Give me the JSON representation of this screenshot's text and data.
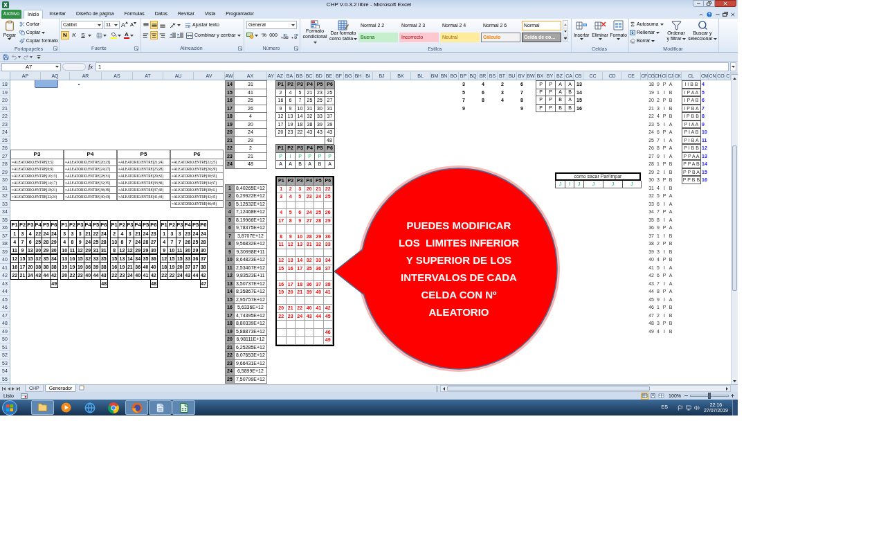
{
  "window": {
    "title": "CHP V.0.3.2 libre - Microsoft Excel"
  },
  "ribbon_tabs": [
    {
      "label": "Archivo",
      "kind": "file",
      "selected": false
    },
    {
      "label": "Inicio",
      "kind": "tab",
      "selected": true
    },
    {
      "label": "Insertar",
      "kind": "tab",
      "selected": false
    },
    {
      "label": "Diseño de página",
      "kind": "tab",
      "selected": false
    },
    {
      "label": "Fórmulas",
      "kind": "tab",
      "selected": false
    },
    {
      "label": "Datos",
      "kind": "tab",
      "selected": false
    },
    {
      "label": "Revisar",
      "kind": "tab",
      "selected": false
    },
    {
      "label": "Vista",
      "kind": "tab",
      "selected": false
    },
    {
      "label": "Programador",
      "kind": "tab",
      "selected": false
    }
  ],
  "clipboard": {
    "group": "Portapapeles",
    "paste": "Pegar",
    "actions": [
      {
        "label": "Cortar",
        "kind": "cut"
      },
      {
        "label": "Copiar",
        "kind": "copy"
      },
      {
        "label": "Copiar formato",
        "kind": "format_painter"
      }
    ]
  },
  "font": {
    "group": "Fuente",
    "family": "Calibri",
    "size": "11",
    "grow": "A",
    "shrink": "A",
    "styles": [
      {
        "label": "N",
        "kind": "bold",
        "selected": true
      },
      {
        "label": "K",
        "kind": "italic",
        "selected": false
      },
      {
        "label": "S",
        "kind": "underline",
        "selected": false
      }
    ],
    "color_glyph": "A"
  },
  "alignment": {
    "group": "Alineación",
    "vertical": [
      {
        "kind": "top",
        "selected": false
      },
      {
        "kind": "middle",
        "selected": true
      },
      {
        "kind": "bottom",
        "selected": false
      }
    ],
    "horizontal": [
      {
        "kind": "left",
        "selected": false
      },
      {
        "kind": "center",
        "selected": true
      },
      {
        "kind": "right",
        "selected": false
      }
    ],
    "wrap": "Ajustar texto",
    "merge": "Combinar y centrar"
  },
  "number": {
    "group": "Número",
    "format": "General",
    "percent": "%",
    "thousands": "000"
  },
  "styles": {
    "group": "Estilos",
    "conditional": "Formato\ncondicional",
    "as_table": "Dar formato\ncomo tabla",
    "gallery": [
      {
        "label": "Normal 2 2",
        "kind": "plain",
        "selected": false
      },
      {
        "label": "Normal 2 3",
        "kind": "plain",
        "selected": false
      },
      {
        "label": "Normal 2 4",
        "kind": "plain",
        "selected": false
      },
      {
        "label": "Normal 2 6",
        "kind": "plain",
        "selected": false
      },
      {
        "label": "Normal",
        "kind": "plain",
        "selected": true
      },
      {
        "label": "Buena",
        "kind": "good",
        "selected": false
      },
      {
        "label": "Incorrecto",
        "kind": "bad",
        "selected": false
      },
      {
        "label": "Neutral",
        "kind": "neutral",
        "selected": false
      },
      {
        "label": "Cálculo",
        "kind": "calc",
        "selected": false
      },
      {
        "label": "Celda de co...",
        "kind": "check",
        "selected": false
      }
    ]
  },
  "cells": {
    "group": "Celdas",
    "buttons": [
      {
        "label": "Insertar",
        "kind": "insert"
      },
      {
        "label": "Eliminar",
        "kind": "delete"
      },
      {
        "label": "Formato",
        "kind": "format"
      }
    ]
  },
  "editing": {
    "group": "Modificar",
    "actions": [
      {
        "label": "Autosuma",
        "kind": "autosum"
      },
      {
        "label": "Rellenar",
        "kind": "fill"
      },
      {
        "label": "Borrar",
        "kind": "clear"
      }
    ],
    "sort": "Ordenar\ny filtrar",
    "find": "Buscar y\nseleccionar"
  },
  "formula_bar": {
    "name_box": "A7",
    "fx": "fx",
    "value": "1"
  },
  "column_headers": [
    "AP",
    "AQ",
    "AR",
    "AS",
    "AT",
    "AU",
    "AV",
    "AW",
    "AX",
    "AY",
    "AZ",
    "BA",
    "BB",
    "BC",
    "BD",
    "BE",
    "BF",
    "BG",
    "BH",
    "BI",
    "BJ",
    "BK",
    "BL",
    "BM",
    "BN",
    "BO",
    "BP",
    "BQ",
    "BR",
    "BS",
    "BT",
    "BU",
    "BV",
    "BW",
    "BX",
    "BY",
    "BZ",
    "CA",
    "CB",
    "CC",
    "CD",
    "CE",
    "CF",
    "CG",
    "CH",
    "CI",
    "CJ",
    "CK",
    "CL",
    "CM",
    "CN",
    "CO",
    "C"
  ],
  "row_headers": [
    "18",
    "19",
    "20",
    "21",
    "22",
    "23",
    "24",
    "25",
    "26",
    "27",
    "28",
    "29",
    "30",
    "31",
    "32",
    "33",
    "34",
    "35",
    "36",
    "37",
    "38",
    "39",
    "40",
    "41",
    "42",
    "43",
    "44",
    "45",
    "46",
    "47",
    "48",
    "49",
    "50",
    "51",
    "52",
    "53",
    "54",
    "55"
  ],
  "sheet": {
    "interval_formulas": [
      {
        "header": "P3",
        "formulas": [
          "=ALEATORIO.ENTRE(3;5)",
          "=ALEATORIO.ENTRE(6;9)",
          "=ALEATORIO.ENTRE(10;13)",
          "=ALEATORIO.ENTRE(14;17)",
          "=ALEATORIO.ENTRE(18;21)",
          "=ALEATORIO.ENTRE(22;24)"
        ]
      },
      {
        "header": "P4",
        "formulas": [
          "=ALEATORIO.ENTRE(20;23)",
          "=ALEATORIO.ENTRE(24;27)",
          "=ALEATORIO.ENTRE(28;31)",
          "=ALEATORIO.ENTRE(32;35)",
          "=ALEATORIO.ENTRE(36;39)",
          "=ALEATORIO.ENTRE(40;43)"
        ]
      },
      {
        "header": "P5",
        "formulas": [
          "=ALEATORIO.ENTRE(21;24)",
          "=ALEATORIO.ENTRE(25;28)",
          "=ALEATORIO.ENTRE(29;32)",
          "=ALEATORIO.ENTRE(33;36)",
          "=ALEATORIO.ENTRE(37;40)",
          "=ALEATORIO.ENTRE(41;44)"
        ]
      },
      {
        "header": "P6",
        "formulas": [
          "=ALEATORIO.ENTRE(22;25)",
          "=ALEATORIO.ENTRE(26;29)",
          "=ALEATORIO.ENTRE(30;33)",
          "=ALEATORIO.ENTRE(34;37)",
          "=ALEATORIO.ENTRE(38;41)",
          "=ALEATORIO.ENTRE(42;45)",
          "=ALEATORIO.ENTRE(46;49)"
        ]
      }
    ],
    "draw_grids": [
      {
        "headers": [
          "P1",
          "P2",
          "P3",
          "P4",
          "P5",
          "P6"
        ],
        "rows": [
          [
            "1",
            "3",
            "4",
            "22",
            "24",
            "24"
          ],
          [
            "4",
            "7",
            "6",
            "25",
            "28",
            "29"
          ],
          [
            "11",
            "9",
            "13",
            "30",
            "29",
            "30"
          ],
          [
            "12",
            "15",
            "15",
            "32",
            "35",
            "34"
          ],
          [
            "16",
            "17",
            "20",
            "38",
            "38",
            "38"
          ],
          [
            "22",
            "21",
            "24",
            "43",
            "44",
            "42"
          ]
        ],
        "extra": "49"
      },
      {
        "headers": [
          "P1",
          "P2",
          "P3",
          "P4",
          "P5",
          "P6"
        ],
        "rows": [
          [
            "3",
            "3",
            "3",
            "21",
            "22",
            "24"
          ],
          [
            "4",
            "8",
            "9",
            "24",
            "25",
            "28"
          ],
          [
            "10",
            "11",
            "12",
            "29",
            "31",
            "31"
          ],
          [
            "13",
            "16",
            "15",
            "32",
            "33",
            "35"
          ],
          [
            "19",
            "19",
            "19",
            "36",
            "39",
            "38"
          ],
          [
            "20",
            "22",
            "23",
            "40",
            "44",
            "43"
          ]
        ],
        "extra": "48"
      },
      {
        "headers": [
          "P1",
          "P2",
          "P3",
          "P4",
          "P5",
          "P6"
        ],
        "rows": [
          [
            "2",
            "4",
            "3",
            "21",
            "24",
            "23"
          ],
          [
            "13",
            "8",
            "7",
            "24",
            "28",
            "27"
          ],
          [
            "8",
            "12",
            "12",
            "29",
            "29",
            "30"
          ],
          [
            "15",
            "13",
            "14",
            "34",
            "35",
            "36"
          ],
          [
            "16",
            "19",
            "21",
            "36",
            "40",
            "40"
          ],
          [
            "22",
            "23",
            "24",
            "40",
            "41",
            "42"
          ]
        ],
        "extra": "48"
      },
      {
        "headers": [
          "P1",
          "P2",
          "P3",
          "P4",
          "P5",
          "P6"
        ],
        "rows": [
          [
            "1",
            "3",
            "3",
            "23",
            "24",
            "24"
          ],
          [
            "4",
            "7",
            "7",
            "26",
            "25",
            "28"
          ],
          [
            "9",
            "10",
            "11",
            "30",
            "29",
            "30"
          ],
          [
            "12",
            "15",
            "15",
            "33",
            "36",
            "37"
          ],
          [
            "18",
            "19",
            "20",
            "37",
            "37",
            "38"
          ],
          [
            "22",
            "22",
            "24",
            "43",
            "44",
            "42"
          ]
        ],
        "extra": "47"
      }
    ],
    "index_values_top": [
      {
        "index": "14",
        "value": "31"
      },
      {
        "index": "15",
        "value": "41"
      },
      {
        "index": "16",
        "value": "25"
      },
      {
        "index": "17",
        "value": "26"
      },
      {
        "index": "18",
        "value": "4"
      },
      {
        "index": "19",
        "value": "20"
      },
      {
        "index": "20",
        "value": "24"
      },
      {
        "index": "21",
        "value": "29"
      },
      {
        "index": "22",
        "value": "2"
      },
      {
        "index": "23",
        "value": "21"
      },
      {
        "index": "24",
        "value": "48"
      }
    ],
    "index_values": [
      {
        "index": "1",
        "value": "8,40265E+12"
      },
      {
        "index": "2",
        "value": "6,29922E+12"
      },
      {
        "index": "3",
        "value": "5,12532E+12"
      },
      {
        "index": "4",
        "value": "7,12468E+12"
      },
      {
        "index": "5",
        "value": "8,19966E+12"
      },
      {
        "index": "6",
        "value": "9,78375E+12"
      },
      {
        "index": "7",
        "value": "3,8707E+12"
      },
      {
        "index": "8",
        "value": "9,56832E+12"
      },
      {
        "index": "9",
        "value": "9,30998E+11"
      },
      {
        "index": "10",
        "value": "8,64823E+12"
      },
      {
        "index": "11",
        "value": "2,53467E+12"
      },
      {
        "index": "12",
        "value": "9,83523E+11"
      },
      {
        "index": "13",
        "value": "3,50737E+12"
      },
      {
        "index": "14",
        "value": "8,35867E+12"
      },
      {
        "index": "15",
        "value": "2,95757E+12"
      },
      {
        "index": "16",
        "value": "5,6336E+12"
      },
      {
        "index": "17",
        "value": "4,74395E+12"
      },
      {
        "index": "18",
        "value": "8,80339E+12"
      },
      {
        "index": "19",
        "value": "5,88873E+12"
      },
      {
        "index": "20",
        "value": "6,98111E+12"
      },
      {
        "index": "21",
        "value": "6,25285E+12"
      },
      {
        "index": "22",
        "value": "8,07653E+12"
      },
      {
        "index": "23",
        "value": "9,66431E+12"
      },
      {
        "index": "24",
        "value": "6,5899E+12"
      },
      {
        "index": "25",
        "value": "7,50799E+12"
      }
    ],
    "combination_table": {
      "headers": [
        "P1",
        "P2",
        "P3",
        "P4",
        "P5",
        "P6"
      ],
      "rows": [
        [
          "2",
          "4",
          "5",
          "21",
          "23",
          "25"
        ],
        [
          "16",
          "6",
          "7",
          "25",
          "25",
          "27"
        ],
        [
          "9",
          "9",
          "10",
          "31",
          "30",
          "31"
        ],
        [
          "12",
          "13",
          "14",
          "32",
          "33",
          "37"
        ],
        [
          "17",
          "19",
          "18",
          "38",
          "39",
          "39"
        ],
        [
          "20",
          "23",
          "22",
          "43",
          "43",
          "43"
        ]
      ],
      "extra": "48"
    },
    "parity_table": {
      "headers": [
        "P1",
        "P2",
        "P3",
        "P4",
        "P5",
        "P6"
      ],
      "parity": [
        "P",
        "I",
        "P",
        "P",
        "P",
        "P"
      ],
      "letters": [
        "A",
        "A",
        "B",
        "A",
        "B",
        "A"
      ]
    },
    "red_table": {
      "headers": [
        "P1",
        "P2",
        "P3",
        "P4",
        "P5",
        "P6"
      ],
      "rows": [
        {
          "kind": "numbers",
          "values": [
            "1",
            "2",
            "3",
            "20",
            "21",
            "22"
          ]
        },
        {
          "kind": "numbers",
          "values": [
            "3",
            "4",
            "5",
            "23",
            "24",
            "25"
          ]
        },
        {
          "kind": "blank"
        },
        {
          "kind": "numbers",
          "values": [
            "4",
            "5",
            "6",
            "24",
            "25",
            "26"
          ]
        },
        {
          "kind": "numbers",
          "values": [
            "17",
            "8",
            "9",
            "27",
            "28",
            "29"
          ]
        },
        {
          "kind": "blank"
        },
        {
          "kind": "numbers",
          "values": [
            "8",
            "9",
            "10",
            "28",
            "29",
            "30"
          ]
        },
        {
          "kind": "numbers",
          "values": [
            "11",
            "12",
            "13",
            "31",
            "32",
            "33"
          ]
        },
        {
          "kind": "blank"
        },
        {
          "kind": "numbers",
          "values": [
            "12",
            "13",
            "14",
            "32",
            "33",
            "34"
          ]
        },
        {
          "kind": "numbers",
          "values": [
            "15",
            "16",
            "17",
            "35",
            "36",
            "37"
          ]
        },
        {
          "kind": "blank"
        },
        {
          "kind": "numbers",
          "values": [
            "16",
            "17",
            "18",
            "36",
            "37",
            "38"
          ]
        },
        {
          "kind": "numbers",
          "values": [
            "19",
            "20",
            "21",
            "39",
            "40",
            "41"
          ]
        },
        {
          "kind": "blank"
        },
        {
          "kind": "numbers",
          "values": [
            "20",
            "21",
            "22",
            "40",
            "41",
            "42"
          ]
        },
        {
          "kind": "numbers",
          "values": [
            "22",
            "23",
            "24",
            "43",
            "44",
            "45"
          ]
        },
        {
          "kind": "blank"
        },
        {
          "kind": "last",
          "value": "46"
        },
        {
          "kind": "last",
          "value": "49"
        }
      ]
    },
    "small_numbers": [
      [
        "3",
        "5",
        "7",
        "9"
      ],
      [
        "4",
        "6",
        "8"
      ],
      [
        "2",
        "3",
        "4"
      ],
      [
        "6",
        "7",
        "8",
        "9"
      ]
    ],
    "pattern_table": [
      {
        "cells": [
          "P",
          "P",
          "A",
          "A"
        ],
        "number": "13"
      },
      {
        "cells": [
          "P",
          "P",
          "A",
          "B"
        ],
        "number": "14"
      },
      {
        "cells": [
          "P",
          "P",
          "B",
          "A"
        ],
        "number": "15"
      },
      {
        "cells": [
          "P",
          "P",
          "B",
          "B"
        ],
        "number": "16"
      }
    ],
    "par_impar_box": {
      "title": "como sacar Par/Impar",
      "cells": [
        "J",
        "I",
        "J",
        "J",
        "J",
        "J"
      ]
    },
    "sequence": [
      {
        "n": "18",
        "digit": "9",
        "parity": "P",
        "group": "A"
      },
      {
        "n": "19",
        "digit": "1",
        "parity": "I",
        "group": "B"
      },
      {
        "n": "20",
        "digit": "2",
        "parity": "P",
        "group": "B"
      },
      {
        "n": "21",
        "digit": "3",
        "parity": "I",
        "group": "B"
      },
      {
        "n": "22",
        "digit": "4",
        "parity": "P",
        "group": "B"
      },
      {
        "n": "23",
        "digit": "5",
        "parity": "I",
        "group": "A"
      },
      {
        "n": "24",
        "digit": "6",
        "parity": "P",
        "group": "A"
      },
      {
        "n": "25",
        "digit": "7",
        "parity": "I",
        "group": "A"
      },
      {
        "n": "26",
        "digit": "8",
        "parity": "P",
        "group": "A"
      },
      {
        "n": "27",
        "digit": "9",
        "parity": "I",
        "group": "A"
      },
      {
        "n": "28",
        "digit": "1",
        "parity": "P",
        "group": "B"
      },
      {
        "n": "29",
        "digit": "2",
        "parity": "I",
        "group": "B"
      },
      {
        "n": "30",
        "digit": "3",
        "parity": "P",
        "group": "B"
      },
      {
        "n": "31",
        "digit": "4",
        "parity": "I",
        "group": "B"
      },
      {
        "n": "32",
        "digit": "5",
        "parity": "P",
        "group": "A"
      },
      {
        "n": "33",
        "digit": "6",
        "parity": "I",
        "group": "A"
      },
      {
        "n": "34",
        "digit": "7",
        "parity": "P",
        "group": "A"
      },
      {
        "n": "35",
        "digit": "8",
        "parity": "I",
        "group": "A"
      },
      {
        "n": "36",
        "digit": "9",
        "parity": "P",
        "group": "A"
      },
      {
        "n": "37",
        "digit": "1",
        "parity": "I",
        "group": "B"
      },
      {
        "n": "38",
        "digit": "2",
        "parity": "P",
        "group": "B"
      },
      {
        "n": "39",
        "digit": "3",
        "parity": "I",
        "group": "B"
      },
      {
        "n": "40",
        "digit": "4",
        "parity": "P",
        "group": "B"
      },
      {
        "n": "41",
        "digit": "5",
        "parity": "I",
        "group": "A"
      },
      {
        "n": "42",
        "digit": "6",
        "parity": "P",
        "group": "A"
      },
      {
        "n": "43",
        "digit": "7",
        "parity": "I",
        "group": "A"
      },
      {
        "n": "44",
        "digit": "8",
        "parity": "P",
        "group": "A"
      },
      {
        "n": "45",
        "digit": "9",
        "parity": "I",
        "group": "A"
      },
      {
        "n": "46",
        "digit": "1",
        "parity": "P",
        "group": "B"
      },
      {
        "n": "47",
        "digit": "2",
        "parity": "I",
        "group": "B"
      },
      {
        "n": "48",
        "digit": "3",
        "parity": "P",
        "group": "B"
      },
      {
        "n": "49",
        "digit": "4",
        "parity": "I",
        "group": "B"
      }
    ],
    "code_list": [
      {
        "code": "I I B B",
        "number": "4"
      },
      {
        "code": "I P A A",
        "number": "5"
      },
      {
        "code": "I P A B",
        "number": "6"
      },
      {
        "code": "I P B A",
        "number": "7"
      },
      {
        "code": "I P B B",
        "number": "8"
      },
      {
        "code": "P I A A",
        "number": "9"
      },
      {
        "code": "P I A B",
        "number": "10"
      },
      {
        "code": "P I B A",
        "number": "11"
      },
      {
        "code": "P I B B",
        "number": "12"
      },
      {
        "code": "P P A A",
        "number": "13"
      },
      {
        "code": "P P A B",
        "number": "14"
      },
      {
        "code": "P P B A",
        "number": "15"
      },
      {
        "code": "P P B B",
        "number": "16"
      }
    ]
  },
  "callout": {
    "text": "PUEDES MODIFICAR\nLOS  LIMITES INFERIOR\nY SUPERIOR DE LOS\nINTERVALOS DE CADA\nCELDA CON Nº\nALEATORIO"
  },
  "sheet_tabs": [
    {
      "label": "CHP",
      "selected": false
    },
    {
      "label": "Generador",
      "selected": true
    }
  ],
  "status_bar": {
    "text": "Listo",
    "views": [
      {
        "kind": "normal",
        "selected": true
      },
      {
        "kind": "page_layout",
        "selected": false
      },
      {
        "kind": "page_break",
        "selected": false
      }
    ],
    "zoom": "100%",
    "zoom_slider": {
      "level": 0.5
    }
  },
  "taskbar": {
    "apps": [
      {
        "kind": "explorer",
        "running": true
      },
      {
        "kind": "media",
        "running": false
      },
      {
        "kind": "browser",
        "running": false
      },
      {
        "kind": "ring",
        "running": false
      },
      {
        "kind": "swirl",
        "running": true
      },
      {
        "kind": "notes",
        "running": true
      },
      {
        "kind": "spreadsheet",
        "running": true
      }
    ],
    "language": "ES",
    "time": "22:16",
    "date": "27/07/2019"
  }
}
